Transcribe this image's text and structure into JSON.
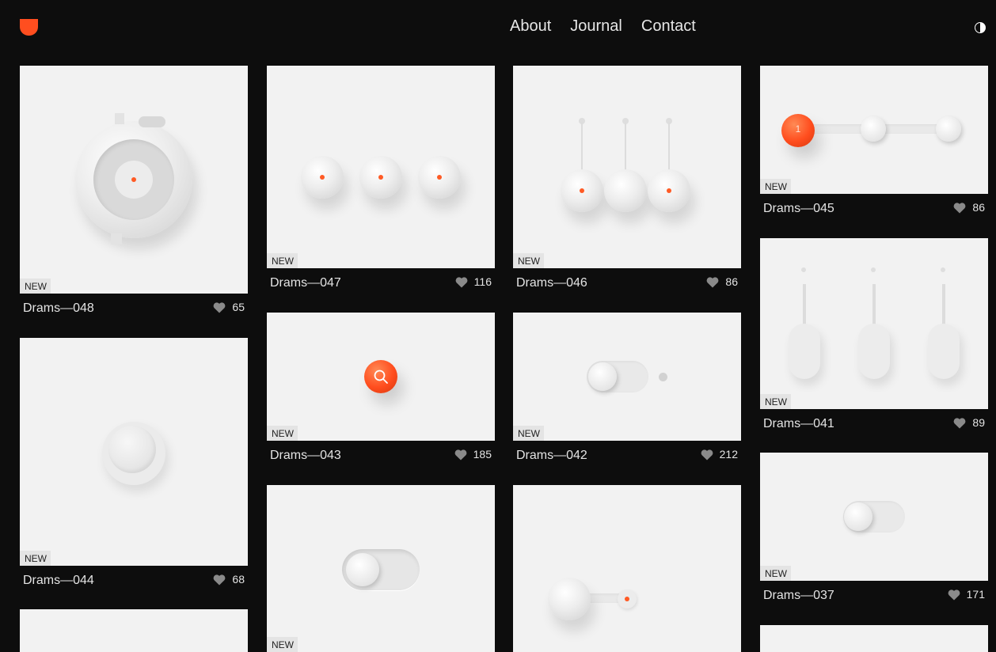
{
  "header": {
    "nav": [
      "About",
      "Journal",
      "Contact"
    ]
  },
  "badge_label": "NEW",
  "cards": [
    {
      "title": "Drams—048",
      "likes": "65"
    },
    {
      "title": "Drams—047",
      "likes": "116"
    },
    {
      "title": "Drams—046",
      "likes": "86"
    },
    {
      "title": "Drams—045",
      "likes": "86"
    },
    {
      "title": "Drams—044",
      "likes": "68"
    },
    {
      "title": "Drams—043",
      "likes": "185"
    },
    {
      "title": "Drams—042",
      "likes": "212"
    },
    {
      "title": "Drams—041",
      "likes": "89"
    },
    {
      "title": "Drams—037",
      "likes": "171"
    }
  ],
  "slider_value": "1",
  "icons": {
    "logo": "shield-logo-icon",
    "theme": "half-moon-theme-icon",
    "like": "heart-icon",
    "search": "search-icon"
  },
  "colors": {
    "accent": "#ff4e1f",
    "background": "#0d0d0d",
    "card": "#f2f2f2"
  }
}
